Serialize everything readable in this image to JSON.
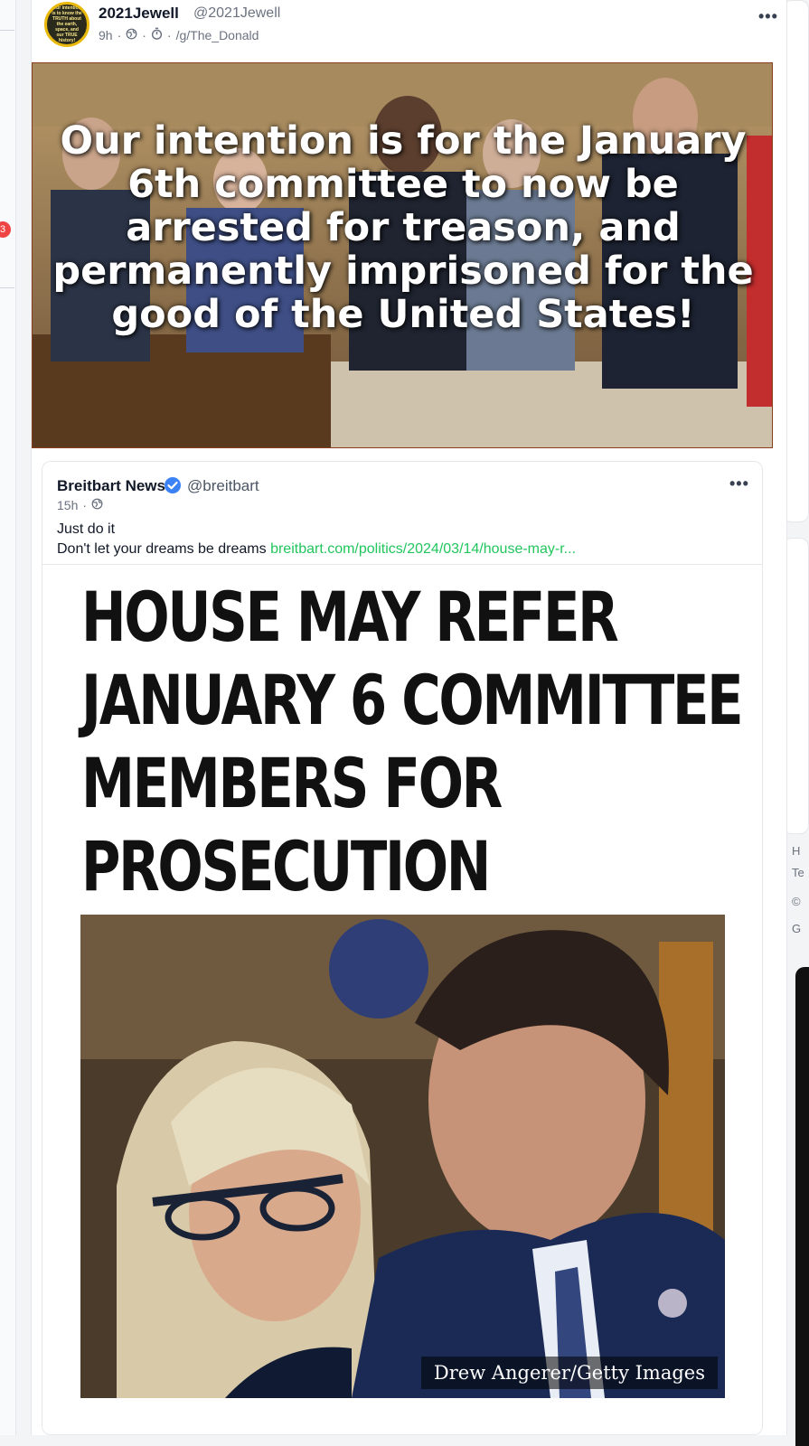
{
  "left_rail": {
    "badge": "3"
  },
  "right_rail": {
    "footer_lines": [
      "H",
      "Te",
      "©",
      "G"
    ]
  },
  "post": {
    "avatar_text": "Our intention is to know the TRUTH about the earth, space, and our TRUE history!",
    "display_name": "2021Jewell",
    "handle": "@2021Jewell",
    "time": "9h",
    "sep": "·",
    "group": "/g/The_Donald",
    "more": "•••",
    "meme_text": "Our intention is for the January 6th committee to now be arrested for treason, and permanently imprisoned for the good of the United States!"
  },
  "quote": {
    "display_name": "Breitbart News",
    "handle": "@breitbart",
    "time": "15h",
    "sep": "·",
    "more": "•••",
    "body_line1": "Just do it",
    "body_line2": "Don't let your dreams be dreams",
    "link": "breitbart.com/politics/2024/03/14/house-may-r...",
    "headline_lines": [
      "HOUSE MAY REFER",
      "JANUARY 6 COMMITTEE",
      "MEMBERS FOR",
      "PROSECUTION"
    ],
    "photo_credit": "Drew Angerer/Getty Images"
  },
  "colors": {
    "link": "#22c55e",
    "verified": "#3b82f6",
    "badge": "#ef4444"
  },
  "icons": {
    "visibility": "globe-icon",
    "verified": "verified-badge-icon",
    "more": "more-icon",
    "timer": "timer-icon"
  }
}
